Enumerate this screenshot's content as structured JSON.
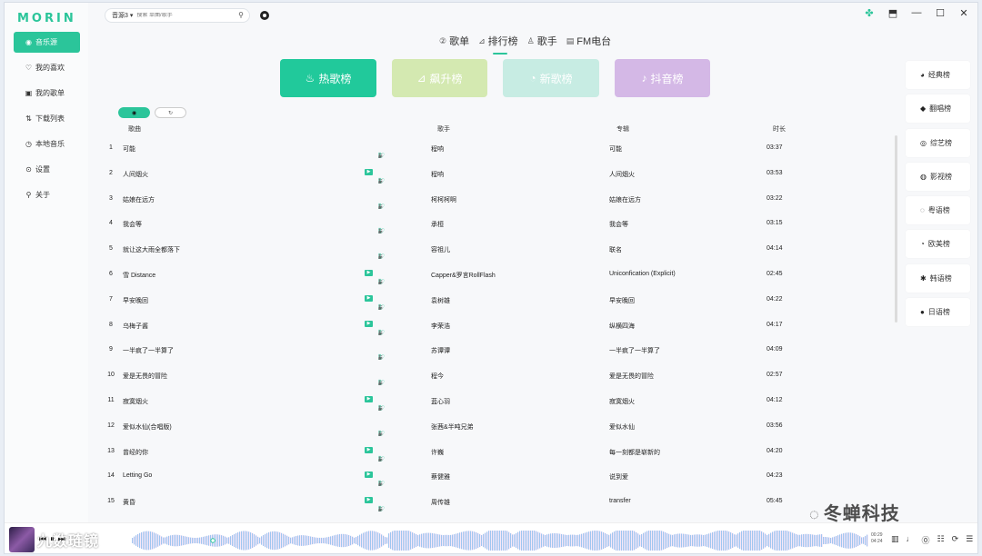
{
  "app": {
    "logo": "MORIN"
  },
  "sidebar": {
    "items": [
      {
        "label": "音乐源",
        "icon": "source-icon",
        "glyph": "◉"
      },
      {
        "label": "我的喜欢",
        "icon": "heart-icon",
        "glyph": "♡"
      },
      {
        "label": "我的歌单",
        "icon": "playlist-icon",
        "glyph": "▣"
      },
      {
        "label": "下载列表",
        "icon": "download-sort-icon",
        "glyph": "⇅"
      },
      {
        "label": "本地音乐",
        "icon": "local-music-icon",
        "glyph": "◷"
      },
      {
        "label": "设置",
        "icon": "settings-toggle-icon",
        "glyph": "⊙"
      },
      {
        "label": "关于",
        "icon": "about-icon",
        "glyph": "⚲"
      }
    ]
  },
  "search": {
    "source": "音源3",
    "placeholder": "搜索 单曲/歌手"
  },
  "window_controls": [
    "clover-icon",
    "pin-icon",
    "minimize-icon",
    "maximize-icon",
    "close-icon"
  ],
  "tabs": [
    {
      "label": "歌单",
      "icon": "playlist-tab-icon",
      "glyph": "②"
    },
    {
      "label": "排行榜",
      "icon": "chart-tab-icon",
      "glyph": "⊿"
    },
    {
      "label": "歌手",
      "icon": "singer-tab-icon",
      "glyph": "♙"
    },
    {
      "label": "FM电台",
      "icon": "radio-tab-icon",
      "glyph": "▤"
    }
  ],
  "banners": [
    {
      "label": "热歌榜",
      "glyph": "♨"
    },
    {
      "label": "飙升榜",
      "glyph": "⊿"
    },
    {
      "label": "新歌榜",
      "glyph": "◔"
    },
    {
      "label": "抖音榜",
      "glyph": "♪"
    }
  ],
  "table": {
    "headers": {
      "song": "歌曲",
      "artist": "歌手",
      "album": "专辑",
      "duration": "时长"
    },
    "rows": [
      {
        "idx": "1",
        "song": "可能",
        "artist": "程响",
        "album": "可能",
        "duration": "03:37",
        "mv": false
      },
      {
        "idx": "2",
        "song": "人间烟火",
        "artist": "程响",
        "album": "人间烟火",
        "duration": "03:53",
        "mv": true
      },
      {
        "idx": "3",
        "song": "姑娘在远方",
        "artist": "柯柯柯啊",
        "album": "姑娘在远方",
        "duration": "03:22",
        "mv": false
      },
      {
        "idx": "4",
        "song": "我会等",
        "artist": "承桓",
        "album": "我会等",
        "duration": "03:15",
        "mv": false
      },
      {
        "idx": "5",
        "song": "就让这大雨全都落下",
        "artist": "容祖儿",
        "album": "联名",
        "duration": "04:14",
        "mv": false
      },
      {
        "idx": "6",
        "song": "雪 Distance",
        "artist": "Capper&罗言RollFlash",
        "album": "Uniconfication (Explicit)",
        "duration": "02:45",
        "mv": true
      },
      {
        "idx": "7",
        "song": "早安晚回",
        "artist": "袁树雄",
        "album": "早安晚回",
        "duration": "04:22",
        "mv": true
      },
      {
        "idx": "8",
        "song": "乌梅子酱",
        "artist": "李荣浩",
        "album": "纵横四海",
        "duration": "04:17",
        "mv": true
      },
      {
        "idx": "9",
        "song": "一半疯了一半算了",
        "artist": "苏谭谭",
        "album": "一半疯了一半算了",
        "duration": "04:09",
        "mv": false
      },
      {
        "idx": "10",
        "song": "爱是无畏的冒险",
        "artist": "程今",
        "album": "爱是无畏的冒险",
        "duration": "02:57",
        "mv": false
      },
      {
        "idx": "11",
        "song": "寂寞烟火",
        "artist": "蓝心羽",
        "album": "寂寞烟火",
        "duration": "04:12",
        "mv": true
      },
      {
        "idx": "12",
        "song": "爱似水仙(合唱版)",
        "artist": "张茜&半吨兄弟",
        "album": "爱似水仙",
        "duration": "03:56",
        "mv": false
      },
      {
        "idx": "13",
        "song": "曾经的你",
        "artist": "许巍",
        "album": "每一刻都是崭新的",
        "duration": "04:20",
        "mv": true
      },
      {
        "idx": "14",
        "song": "Letting Go",
        "artist": "蔡健雅",
        "album": "说到爱",
        "duration": "04:23",
        "mv": true
      },
      {
        "idx": "15",
        "song": "黄昏",
        "artist": "周传雄",
        "album": "transfer",
        "duration": "05:45",
        "mv": true
      }
    ]
  },
  "ranks": [
    {
      "label": "经典榜",
      "glyph": "◕"
    },
    {
      "label": "翻唱榜",
      "glyph": "◆"
    },
    {
      "label": "综艺榜",
      "glyph": "◎"
    },
    {
      "label": "影视榜",
      "glyph": "◍"
    },
    {
      "label": "粤语榜",
      "glyph": "◌"
    },
    {
      "label": "欧美榜",
      "glyph": "◔"
    },
    {
      "label": "韩语榜",
      "glyph": "✱"
    },
    {
      "label": "日语榜",
      "glyph": "●"
    }
  ],
  "player": {
    "now_playing": "九数琏镜",
    "current_time": "00:29",
    "total_time": "04:24",
    "progress": 0.11
  },
  "watermark": "冬蝉科技"
}
